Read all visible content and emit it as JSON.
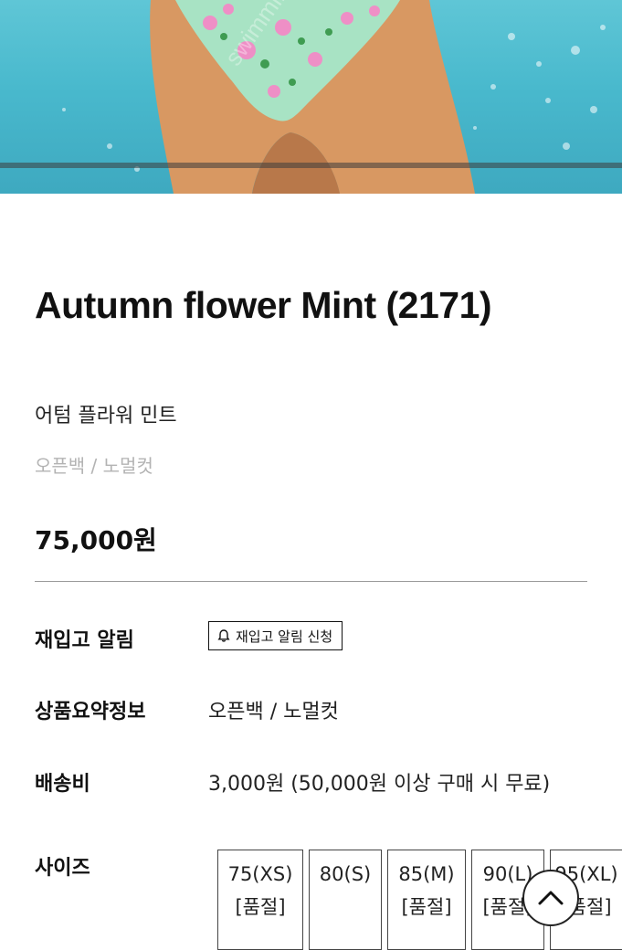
{
  "hero": {
    "watermark": "swimmingholicclub"
  },
  "product": {
    "title": "Autumn flower Mint (2171)",
    "name_ko": "어텀 플라워 민트",
    "tags": "오픈백 / 노멀컷",
    "price": "75,000원"
  },
  "restock": {
    "label": "재입고 알림",
    "button": "재입고 알림 신청",
    "icon": "bell-icon"
  },
  "summary": {
    "label": "상품요약정보",
    "value": "오픈백 / 노멀컷"
  },
  "shipping": {
    "label": "배송비",
    "value": "3,000원 (50,000원 이상 구매 시 무료)"
  },
  "size": {
    "label": "사이즈",
    "options": [
      {
        "name": "75(XS)",
        "status": "[품절]"
      },
      {
        "name": "80(S)",
        "status": ""
      },
      {
        "name": "85(M)",
        "status": "[품절]"
      },
      {
        "name": "90(L)",
        "status": "[품절]"
      },
      {
        "name": "95(XL)",
        "status": "[품절]"
      }
    ]
  },
  "scroll_top": {
    "icon": "chevron-up-icon"
  },
  "colors": {
    "pool": "#4ab9cd",
    "swimsuit": "#a8e3c4",
    "skin": "#d7955f"
  }
}
